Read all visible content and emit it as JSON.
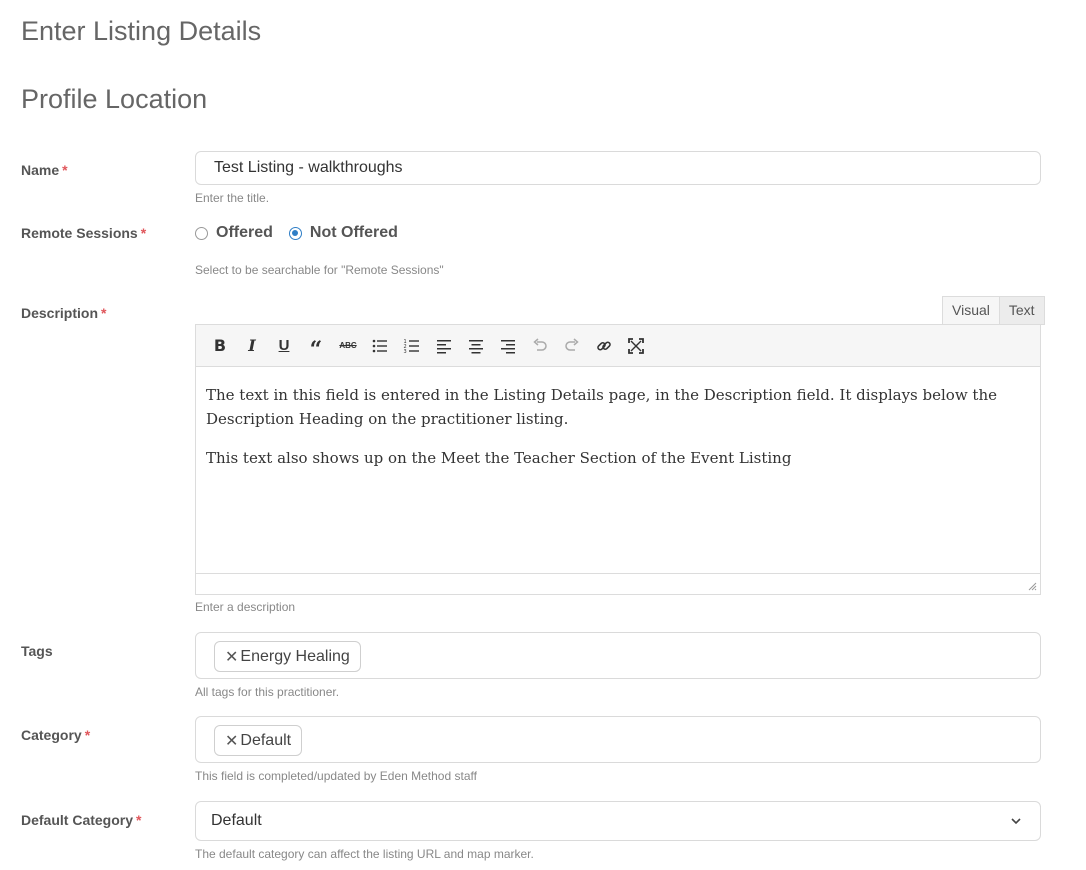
{
  "page": {
    "title": "Enter Listing Details",
    "section_title": "Profile Location"
  },
  "fields": {
    "name": {
      "label": "Name",
      "required_mark": "*",
      "value": "Test Listing - walkthroughs",
      "help": "Enter the title."
    },
    "remote_sessions": {
      "label": "Remote Sessions",
      "required_mark": "*",
      "options": [
        "Offered",
        "Not Offered"
      ],
      "selected": "Not Offered",
      "help": "Select to be searchable for \"Remote Sessions\""
    },
    "description": {
      "label": "Description",
      "required_mark": "*",
      "tabs": [
        "Visual",
        "Text"
      ],
      "active_tab": "Visual",
      "toolbar": [
        "bold",
        "italic",
        "underline",
        "blockquote",
        "strikethrough",
        "bullet-list",
        "numbered-list",
        "align-left",
        "align-center",
        "align-right",
        "undo",
        "redo",
        "link",
        "fullscreen"
      ],
      "paragraphs": [
        "The text in this field is entered in the Listing Details page, in the Description field. It displays below the Description Heading on the practitioner listing.",
        "This text also shows up on the Meet the Teacher Section of the Event Listing"
      ],
      "help": "Enter a description"
    },
    "tags": {
      "label": "Tags",
      "values": [
        "Energy Healing"
      ],
      "help": "All tags for this practitioner."
    },
    "category": {
      "label": "Category",
      "required_mark": "*",
      "values": [
        "Default"
      ],
      "help": "This field is completed/updated by Eden Method staff"
    },
    "default_category": {
      "label": "Default Category",
      "required_mark": "*",
      "value": "Default",
      "help": "The default category can affect the listing URL and map marker."
    }
  },
  "colors": {
    "accent": "#2f7ec6",
    "required": "#e0565b",
    "border": "#dadada"
  }
}
